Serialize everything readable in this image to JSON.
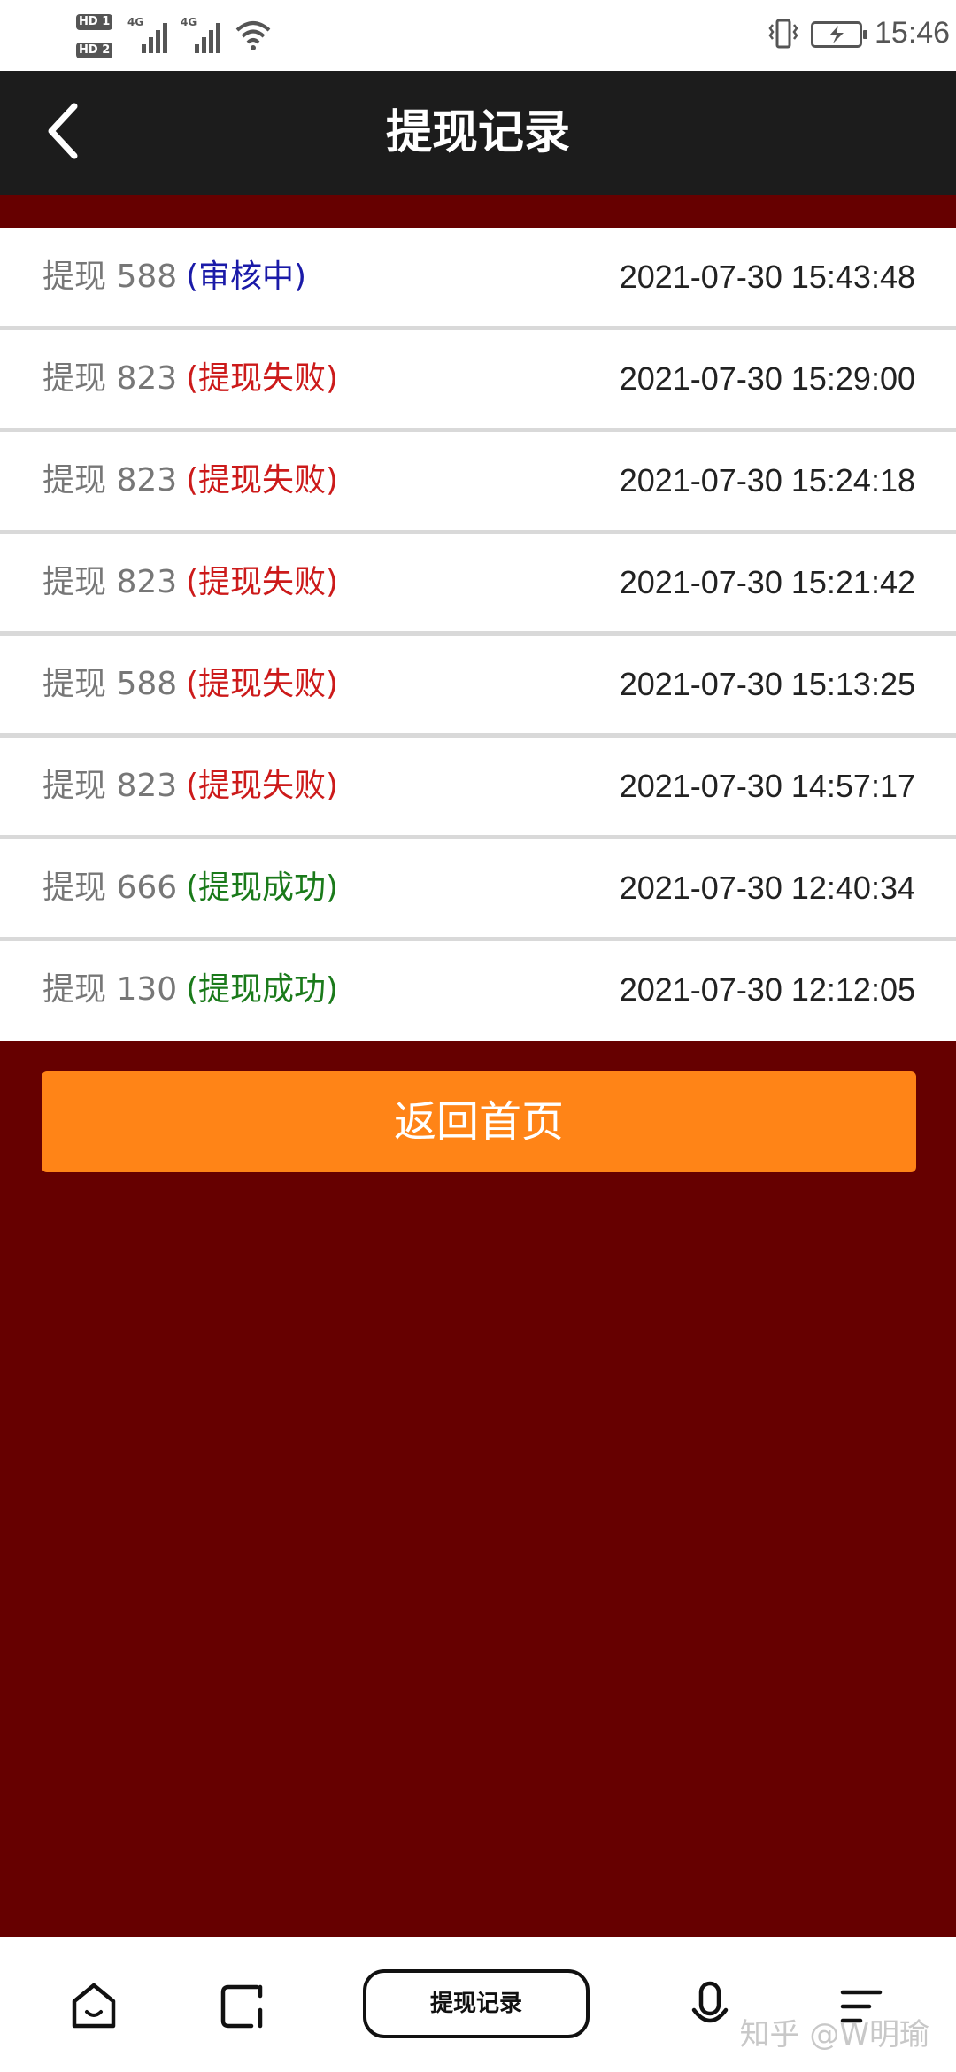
{
  "status_bar": {
    "sim1": "HD 1",
    "sim2": "HD 2",
    "net1": "4G",
    "net2": "4G",
    "time": "15:46",
    "icons": [
      "signal-icon",
      "wifi-icon",
      "vibrate-icon",
      "battery-charging-icon"
    ]
  },
  "header": {
    "title": "提现记录",
    "back_icon": "chevron-left-icon"
  },
  "records": [
    {
      "label": "提现 588",
      "status": "(审核中)",
      "status_color": "#1a1aa8",
      "time": "2021-07-30 15:43:48"
    },
    {
      "label": "提现 823",
      "status": "(提现失败)",
      "status_color": "#cc1a1a",
      "time": "2021-07-30 15:29:00"
    },
    {
      "label": "提现 823",
      "status": "(提现失败)",
      "status_color": "#cc1a1a",
      "time": "2021-07-30 15:24:18"
    },
    {
      "label": "提现 823",
      "status": "(提现失败)",
      "status_color": "#cc1a1a",
      "time": "2021-07-30 15:21:42"
    },
    {
      "label": "提现 588",
      "status": "(提现失败)",
      "status_color": "#cc1a1a",
      "time": "2021-07-30 15:13:25"
    },
    {
      "label": "提现 823",
      "status": "(提现失败)",
      "status_color": "#cc1a1a",
      "time": "2021-07-30 14:57:17"
    },
    {
      "label": "提现 666",
      "status": "(提现成功)",
      "status_color": "#1a7a1a",
      "time": "2021-07-30 12:40:34"
    },
    {
      "label": "提现 130",
      "status": "(提现成功)",
      "status_color": "#1a7a1a",
      "time": "2021-07-30 12:12:05"
    }
  ],
  "home_button": {
    "label": "返回首页",
    "color": "#ff8417"
  },
  "bottom_nav": {
    "active_label": "提现记录",
    "icons": [
      "home-icon",
      "tabs-icon",
      "mic-icon",
      "menu-icon"
    ]
  },
  "watermark": "知乎 @W明瑜",
  "colors": {
    "background": "#660000",
    "header": "#1c1c1c"
  }
}
